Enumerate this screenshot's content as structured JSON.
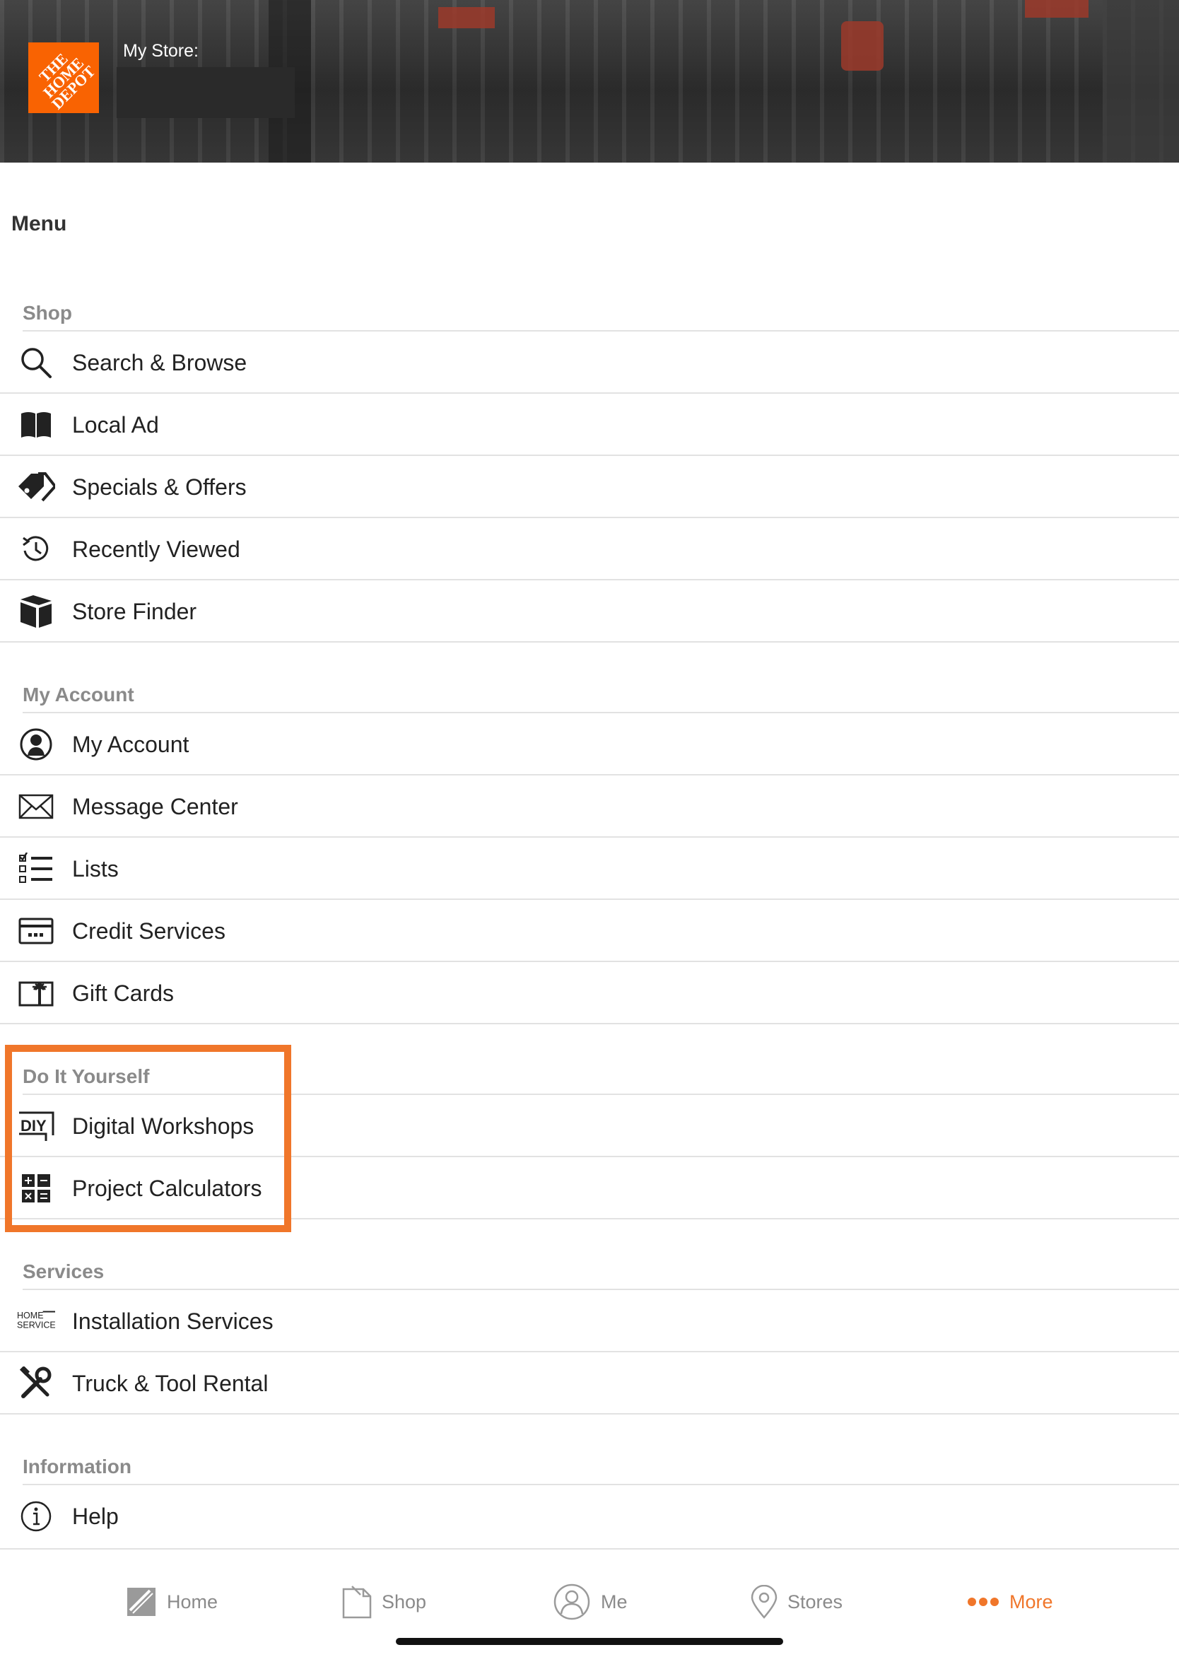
{
  "header": {
    "logo_text": "THE HOME DEPOT",
    "store_label": "My Store:"
  },
  "menu": {
    "title": "Menu",
    "sections": [
      {
        "title": "Shop",
        "items": [
          {
            "label": "Search & Browse",
            "icon": "search-icon"
          },
          {
            "label": "Local Ad",
            "icon": "book-icon"
          },
          {
            "label": "Specials & Offers",
            "icon": "tag-icon"
          },
          {
            "label": "Recently Viewed",
            "icon": "history-icon"
          },
          {
            "label": "Store Finder",
            "icon": "map-icon"
          }
        ]
      },
      {
        "title": "My Account",
        "items": [
          {
            "label": "My Account",
            "icon": "user-icon"
          },
          {
            "label": "Message Center",
            "icon": "envelope-icon"
          },
          {
            "label": "Lists",
            "icon": "checklist-icon"
          },
          {
            "label": "Credit Services",
            "icon": "credit-card-icon"
          },
          {
            "label": "Gift Cards",
            "icon": "gift-card-icon"
          }
        ]
      },
      {
        "title": "Do It Yourself",
        "items": [
          {
            "label": "Digital Workshops",
            "icon": "diy-icon",
            "icon_text": "DIY"
          },
          {
            "label": "Project Calculators",
            "icon": "calculator-icon"
          }
        ]
      },
      {
        "title": "Services",
        "items": [
          {
            "label": "Installation Services",
            "icon": "home-services-icon",
            "icon_text_1": "HOME",
            "icon_text_2": "SERVICES"
          },
          {
            "label": "Truck & Tool Rental",
            "icon": "tools-icon"
          }
        ]
      },
      {
        "title": "Information",
        "items": [
          {
            "label": "Help",
            "icon": "info-icon"
          }
        ]
      }
    ]
  },
  "tabbar": {
    "tabs": [
      {
        "label": "Home",
        "icon": "home-depot-icon"
      },
      {
        "label": "Shop",
        "icon": "shop-icon"
      },
      {
        "label": "Me",
        "icon": "user-circle-icon"
      },
      {
        "label": "Stores",
        "icon": "location-pin-icon"
      },
      {
        "label": "More",
        "icon": "more-dots-icon",
        "active": true
      }
    ]
  },
  "colors": {
    "accent": "#f0762a",
    "brand_orange": "#f96302",
    "section_gray": "#8a8a8a",
    "divider": "#e2e2e2"
  }
}
